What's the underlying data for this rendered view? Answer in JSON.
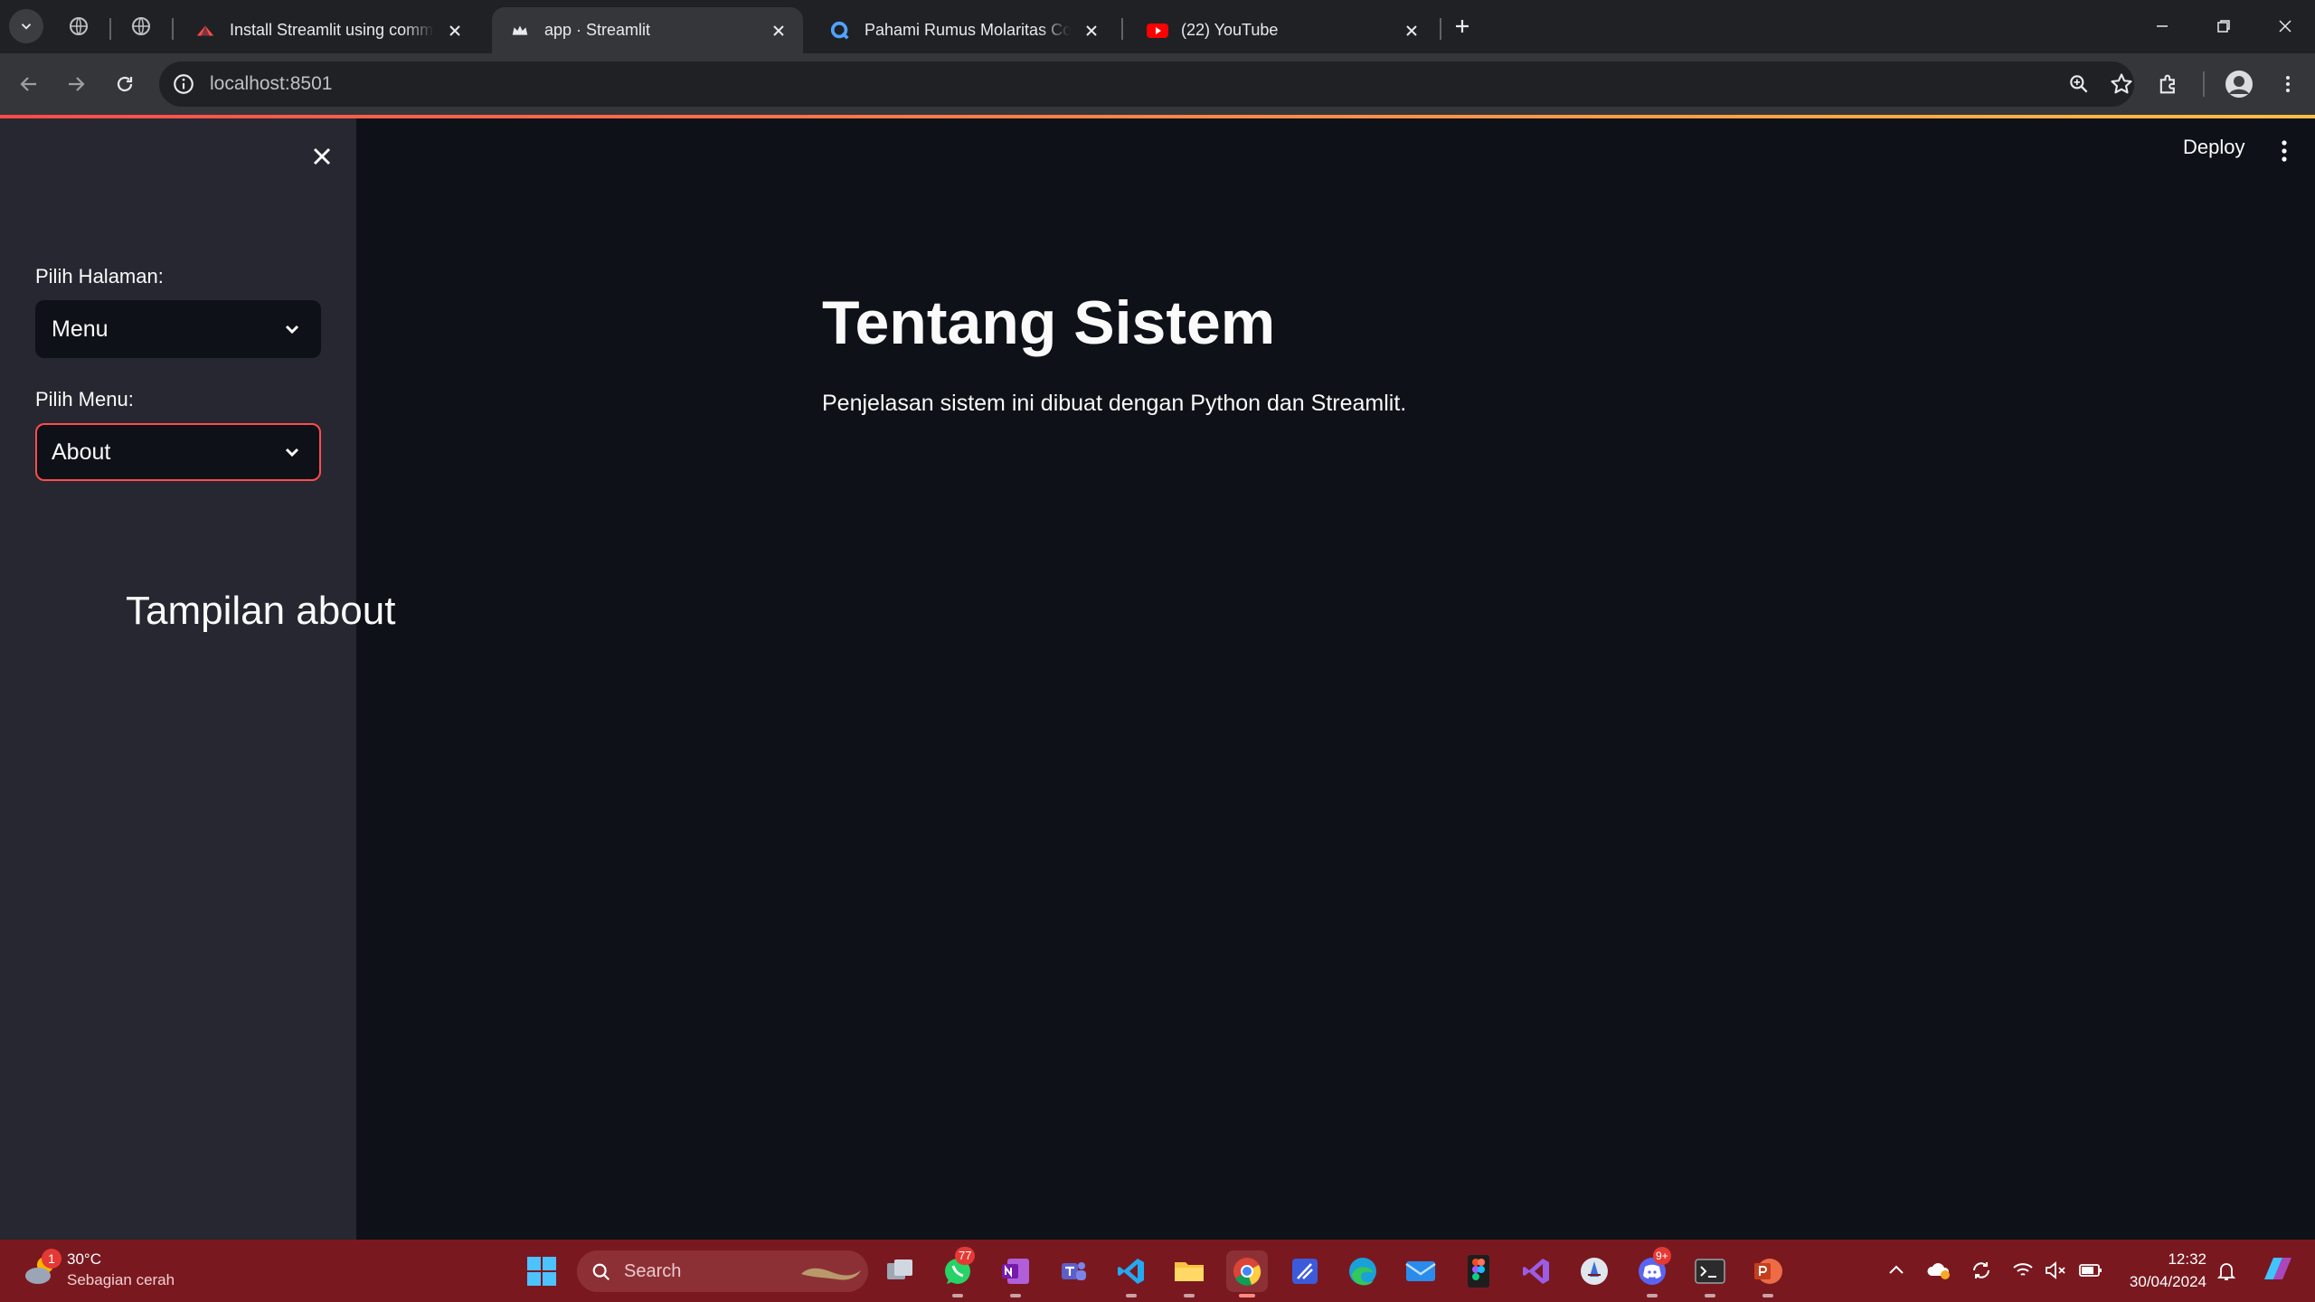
{
  "browser": {
    "tabs": [
      {
        "title": "Install Streamlit using comman",
        "active": false
      },
      {
        "title": "app · Streamlit",
        "active": true
      },
      {
        "title": "Pahami Rumus Molaritas Contoh",
        "active": false
      },
      {
        "title": "(22) YouTube",
        "active": false
      }
    ],
    "url": "localhost:8501"
  },
  "sidebar": {
    "page_label": "Pilih Halaman:",
    "page_value": "Menu",
    "menu_label": "Pilih Menu:",
    "menu_value": "About",
    "annotation": "Tampilan about"
  },
  "main": {
    "deploy_label": "Deploy",
    "title": "Tentang Sistem",
    "description": "Penjelasan sistem ini dibuat dengan Python dan Streamlit."
  },
  "taskbar": {
    "weather_temp": "30°C",
    "weather_desc": "Sebagian cerah",
    "weather_badge": "1",
    "search_placeholder": "Search",
    "whatsapp_badge": "77",
    "discord_badge": "9+",
    "time": "12:32",
    "date": "30/04/2024"
  },
  "colors": {
    "accent": "#ff4b4b",
    "app_bg": "#0e1117",
    "sidebar_bg": "#262730",
    "taskbar_bg": "#7a1820"
  }
}
